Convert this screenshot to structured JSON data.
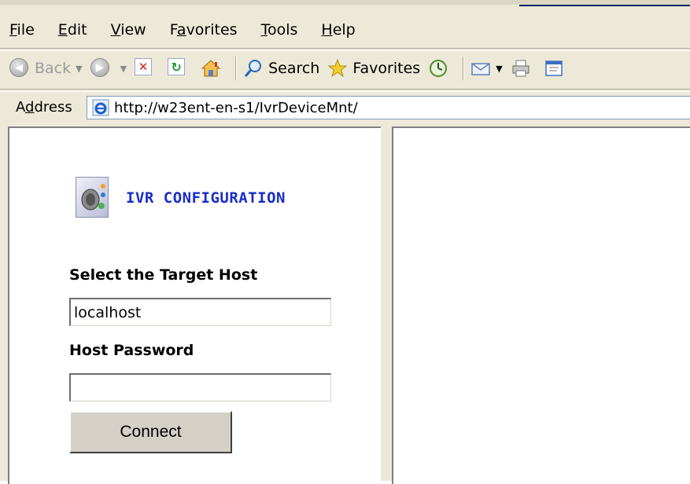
{
  "menu": {
    "items": [
      {
        "label": "File",
        "key": "F",
        "rest": "ile"
      },
      {
        "label": "Edit",
        "key": "E",
        "rest": "dit"
      },
      {
        "label": "View",
        "key": "V",
        "rest": "iew"
      },
      {
        "label": "Favorites",
        "pre": "F",
        "key": "a",
        "rest": "vorites"
      },
      {
        "label": "Tools",
        "key": "T",
        "rest": "ools"
      },
      {
        "label": "Help",
        "key": "H",
        "rest": "elp"
      }
    ]
  },
  "toolbar": {
    "back_label": "Back",
    "search_label": "Search",
    "favorites_label": "Favorites"
  },
  "address": {
    "label_pre": "A",
    "label_key": "d",
    "label_rest": "dress",
    "url": "http://w23ent-en-s1/IvrDeviceMnt/"
  },
  "app": {
    "title": "IVR CONFIGURATION",
    "target_host_label": "Select the Target Host",
    "target_host_value": "localhost",
    "password_label": "Host Password",
    "password_value": "",
    "connect_label": "Connect"
  },
  "colors": {
    "title_blue": "#1a2ec8",
    "chrome_bg": "#ece9d8",
    "stop_red": "#d21f1f",
    "refresh_green": "#1d9a2b"
  }
}
